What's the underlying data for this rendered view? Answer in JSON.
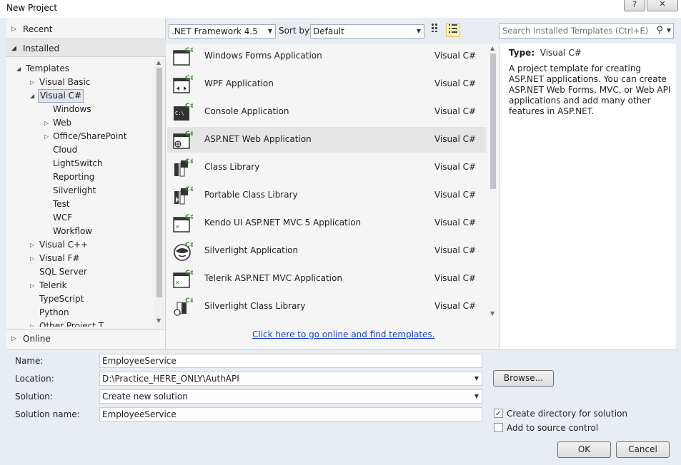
{
  "window": {
    "title": "New Project",
    "help_label": "?",
    "close_label": "✕"
  },
  "nav": {
    "recent": "Recent",
    "installed": "Installed",
    "online": "Online"
  },
  "tree": {
    "templates": "Templates",
    "visual_basic": "Visual Basic",
    "visual_csharp": "Visual C#",
    "windows": "Windows",
    "web": "Web",
    "office_sharepoint": "Office/SharePoint",
    "cloud": "Cloud",
    "lightswitch": "LightSwitch",
    "reporting": "Reporting",
    "silverlight": "Silverlight",
    "test": "Test",
    "wcf": "WCF",
    "workflow": "Workflow",
    "visual_cpp": "Visual C++",
    "visual_fsharp": "Visual F#",
    "sql_server": "SQL Server",
    "telerik": "Telerik",
    "typescript": "TypeScript",
    "python": "Python",
    "other_project_types": "Other Project T"
  },
  "toolbar": {
    "framework": ".NET Framework 4.5",
    "sort_label": "Sort by:",
    "sort_value": "Default"
  },
  "search": {
    "placeholder": "Search Installed Templates (Ctrl+E)"
  },
  "templates": [
    {
      "name": "Windows Forms Application",
      "lang": "Visual C#",
      "icon": "winforms-icon"
    },
    {
      "name": "WPF Application",
      "lang": "Visual C#",
      "icon": "wpf-icon"
    },
    {
      "name": "Console Application",
      "lang": "Visual C#",
      "icon": "console-icon"
    },
    {
      "name": "ASP.NET Web Application",
      "lang": "Visual C#",
      "icon": "aspnet-icon"
    },
    {
      "name": "Class Library",
      "lang": "Visual C#",
      "icon": "class-library-icon"
    },
    {
      "name": "Portable Class Library",
      "lang": "Visual C#",
      "icon": "portable-library-icon"
    },
    {
      "name": "Kendo UI ASP.NET MVC 5 Application",
      "lang": "Visual C#",
      "icon": "kendo-icon"
    },
    {
      "name": "Silverlight Application",
      "lang": "Visual C#",
      "icon": "silverlight-icon"
    },
    {
      "name": "Telerik ASP.NET MVC Application",
      "lang": "Visual C#",
      "icon": "telerik-mvc-icon"
    },
    {
      "name": "Silverlight Class Library",
      "lang": "Visual C#",
      "icon": "silverlight-library-icon"
    }
  ],
  "online_link": "Click here to go online and find templates.",
  "description": {
    "type_label": "Type:",
    "type_value": "Visual C#",
    "text": "A project template for creating ASP.NET applications. You can create ASP.NET Web Forms, MVC,  or Web API applications and add many other features in ASP.NET."
  },
  "form": {
    "name_label": "Name:",
    "name_value": "EmployeeService",
    "location_label": "Location:",
    "location_value": "D:\\Practice_HERE_ONLY\\AuthAPI",
    "solution_label": "Solution:",
    "solution_value": "Create new solution",
    "solution_name_label": "Solution name:",
    "solution_name_value": "EmployeeService",
    "browse_label": "Browse...",
    "create_dir_label": "Create directory for solution",
    "create_dir_checked": true,
    "source_control_label": "Add to source control",
    "source_control_checked": false,
    "ok_label": "OK",
    "cancel_label": "Cancel"
  },
  "colors": {
    "csharp_green": "#3c8a2e",
    "link_blue": "#1a3fbf",
    "selected_row": "#e5e5e5"
  }
}
